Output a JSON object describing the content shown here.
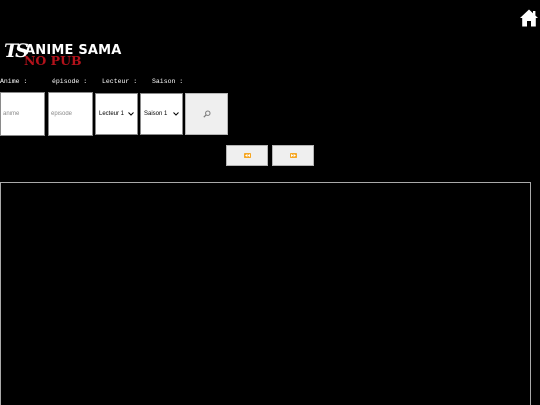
{
  "header": {
    "logo": {
      "mark": "TS",
      "title": "ANIME SAMA",
      "subtitle": "NO PUB"
    },
    "home_icon": "home-icon"
  },
  "form": {
    "labels": {
      "anime": "Anime :",
      "episode": "épisode :",
      "lecteur": "Lecteur :",
      "saison": "Saison :"
    },
    "anime_input": {
      "value": "",
      "placeholder": "anime"
    },
    "episode_input": {
      "value": "",
      "placeholder": "épisode"
    },
    "lecteur_select": {
      "selected": "Lecteur 1"
    },
    "saison_select": {
      "selected": "Saison 1"
    },
    "search_icon": "magnifier-icon"
  },
  "navigation": {
    "previous_icon": "rewind-icon",
    "next_icon": "fast-forward-icon"
  },
  "colors": {
    "background": "#000000",
    "text": "#ffffff",
    "accent_red": "#b3121b",
    "button_bg": "#efefef",
    "nav_icon": "#f5a623",
    "frame_border": "#a9a9a9"
  }
}
